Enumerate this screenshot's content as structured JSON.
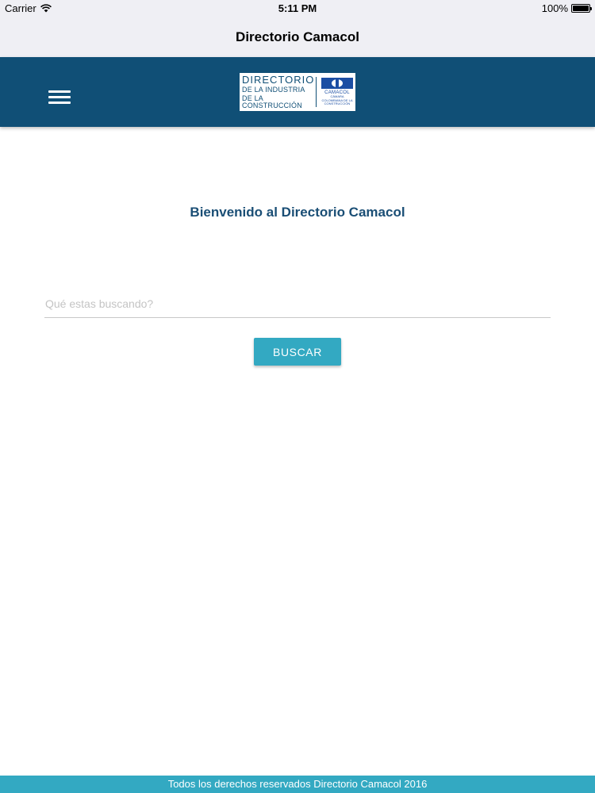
{
  "status_bar": {
    "carrier": "Carrier",
    "time": "5:11 PM",
    "battery": "100%"
  },
  "nav": {
    "title": "Directorio Camacol"
  },
  "header": {
    "logo": {
      "line1": "DIRECTORIO",
      "line2": "DE LA INDUSTRIA",
      "line3": "DE LA CONSTRUCCIÓN",
      "brand": "CAMACOL",
      "sub": "CÁMARA COLOMBIANA DE LA CONSTRUCCIÓN"
    },
    "menu_icon": "hamburger-menu-icon"
  },
  "main": {
    "welcome": "Bienvenido al Directorio Camacol",
    "search_placeholder": "Qué estas buscando?",
    "search_value": "",
    "search_button": "BUSCAR"
  },
  "footer": {
    "text": "Todos los derechos reservados Directorio Camacol 2016"
  },
  "colors": {
    "header_bg": "#104f76",
    "accent": "#33a9c2",
    "title_text": "#1a4e75",
    "nav_bg": "#efeff4"
  }
}
